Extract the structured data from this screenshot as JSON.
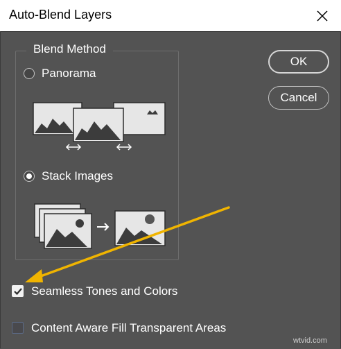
{
  "dialog": {
    "title": "Auto-Blend Layers",
    "close_icon": "close-icon"
  },
  "blend_method": {
    "legend": "Blend Method",
    "options": [
      {
        "label": "Panorama",
        "selected": false,
        "illustration_icon": "panorama-illustration-icon"
      },
      {
        "label": "Stack Images",
        "selected": true,
        "illustration_icon": "stack-images-illustration-icon"
      }
    ]
  },
  "buttons": {
    "ok_label": "OK",
    "cancel_label": "Cancel"
  },
  "options": {
    "seamless_label": "Seamless Tones and Colors",
    "seamless_checked": true,
    "content_aware_label": "Content Aware Fill Transparent Areas",
    "content_aware_checked": false
  },
  "annotation": {
    "arrow_icon": "annotation-arrow-icon",
    "arrow_color": "#f0b400"
  },
  "watermark": "wtvid.com",
  "colors": {
    "background": "#535353",
    "titlebar": "#ffffff",
    "text": "#ffffff",
    "accent_arrow": "#f0b400"
  }
}
